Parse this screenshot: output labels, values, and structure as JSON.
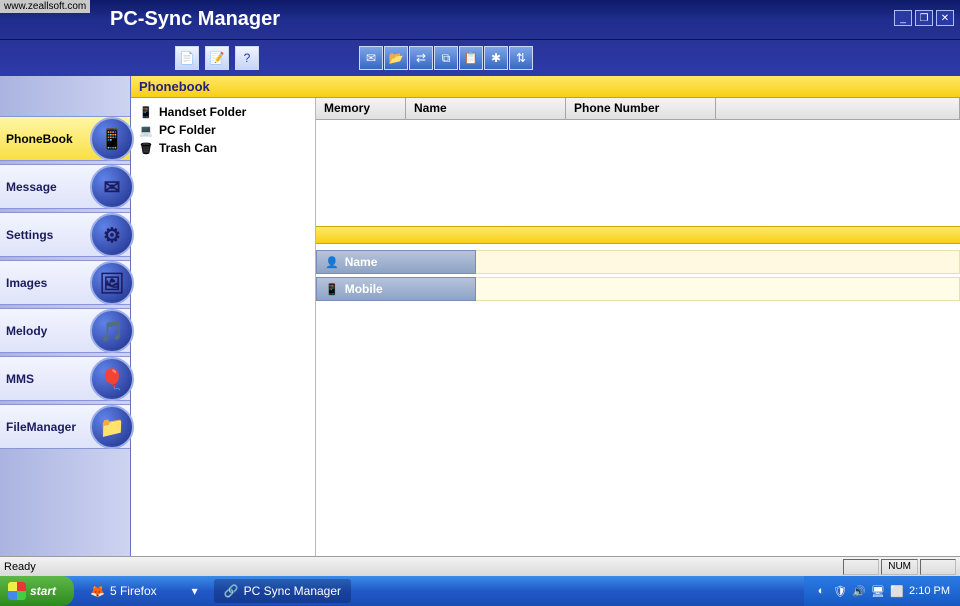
{
  "watermark": "www.zeallsoft.com",
  "app_title": "PC-Sync Manager",
  "window_controls": {
    "min": "_",
    "max": "❐",
    "close": "✕"
  },
  "toolbar_icons": {
    "group1": [
      "doc-icon",
      "edit-icon",
      "help-icon"
    ],
    "group2": [
      "mail-icon",
      "open-icon",
      "swap-icon",
      "copy-icon",
      "paste-icon",
      "web-icon",
      "sort-icon"
    ]
  },
  "sidebar": {
    "items": [
      {
        "label": "PhoneBook",
        "icon": "📱",
        "name": "nav-phonebook",
        "active": true
      },
      {
        "label": "Message",
        "icon": "✉",
        "name": "nav-message"
      },
      {
        "label": "Settings",
        "icon": "⚙",
        "name": "nav-settings"
      },
      {
        "label": "Images",
        "icon": "🖼",
        "name": "nav-images"
      },
      {
        "label": "Melody",
        "icon": "🎵",
        "name": "nav-melody"
      },
      {
        "label": "MMS",
        "icon": "🎈",
        "name": "nav-mms"
      },
      {
        "label": "FileManager",
        "icon": "📁",
        "name": "nav-filemanager"
      }
    ]
  },
  "section_title": "Phonebook",
  "tree": {
    "items": [
      {
        "label": "Handset Folder",
        "icon": "📱",
        "name": "tree-handset-folder"
      },
      {
        "label": "PC Folder",
        "icon": "💻",
        "name": "tree-pc-folder"
      },
      {
        "label": "Trash Can",
        "icon": "🗑",
        "name": "tree-trash-can"
      }
    ]
  },
  "grid": {
    "cols": {
      "memory": "Memory",
      "name": "Name",
      "phone": "Phone Number"
    }
  },
  "detail": {
    "rows": [
      {
        "label": "Name",
        "icon": "👤",
        "name": "detail-name"
      },
      {
        "label": "Mobile",
        "icon": "📱",
        "name": "detail-mobile"
      }
    ]
  },
  "statusbar": {
    "ready": "Ready",
    "num": "NUM"
  },
  "taskbar": {
    "start": "start",
    "firefox": "5 Firefox",
    "app": "PC Sync Manager",
    "clock": "2:10 PM"
  }
}
